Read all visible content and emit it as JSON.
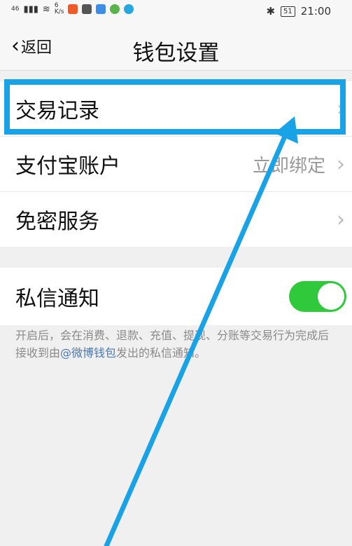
{
  "status_bar": {
    "network": "46",
    "speed_top": "6",
    "speed_unit": "K/s",
    "bluetooth": "✱",
    "battery": "51",
    "time": "21:00"
  },
  "nav": {
    "back_label": "返回",
    "title": "钱包设置"
  },
  "list": {
    "transactions": {
      "label": "交易记录"
    },
    "alipay": {
      "label": "支付宝账户",
      "value": "立即绑定"
    },
    "password_free": {
      "label": "免密服务"
    },
    "private_message": {
      "label": "私信通知",
      "enabled": true
    }
  },
  "description": {
    "before": "开启后，会在消费、退款、充值、提现、分账等交易行为完成后接收到由",
    "link": "@微博钱包",
    "after": "发出的私信通知。"
  },
  "colors": {
    "highlight": "#19a3e6",
    "toggle_on": "#2fc93b",
    "link": "#4a78b5"
  }
}
